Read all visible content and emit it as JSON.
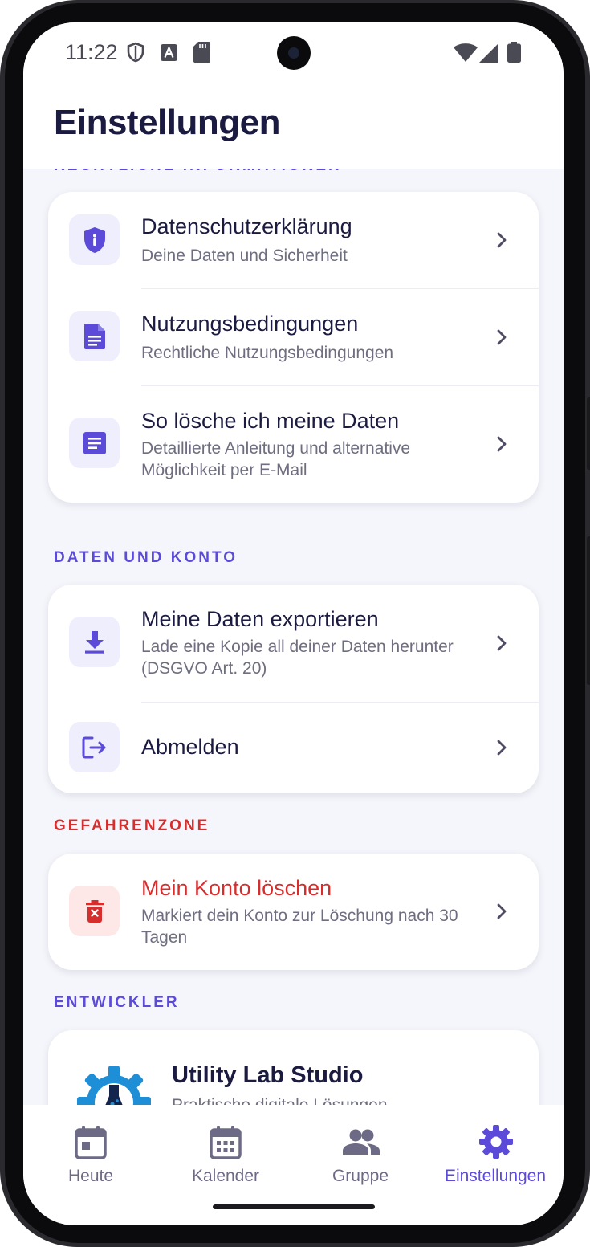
{
  "status": {
    "time": "11:22"
  },
  "header": {
    "title": "Einstellungen"
  },
  "sections": {
    "legal": {
      "label": "RECHTLICHE INFORMATIONEN",
      "items": [
        {
          "title": "Datenschutzerklärung",
          "subtitle": "Deine Daten und Sicherheit",
          "icon": "shield-info-icon"
        },
        {
          "title": "Nutzungsbedingungen",
          "subtitle": "Rechtliche Nutzungsbedingungen",
          "icon": "document-icon"
        },
        {
          "title": "So lösche ich meine Daten",
          "subtitle": "Detaillierte Anleitung und alternative Möglichkeit per E-Mail",
          "icon": "article-icon"
        }
      ]
    },
    "account": {
      "label": "DATEN UND KONTO",
      "items": [
        {
          "title": "Meine Daten exportieren",
          "subtitle": "Lade eine Kopie all deiner Daten herunter (DSGVO Art. 20)",
          "icon": "download-icon"
        },
        {
          "title": "Abmelden",
          "icon": "logout-icon"
        }
      ]
    },
    "danger": {
      "label": "GEFAHRENZONE",
      "items": [
        {
          "title": "Mein Konto löschen",
          "subtitle": "Markiert dein Konto zur Löschung nach 30 Tagen",
          "icon": "delete-icon"
        }
      ]
    },
    "developer": {
      "label": "ENTWICKLER",
      "name": "Utility Lab Studio",
      "tagline": "Praktische digitale Lösungen"
    }
  },
  "nav": {
    "items": [
      {
        "label": "Heute",
        "icon": "calendar-today-icon"
      },
      {
        "label": "Kalender",
        "icon": "calendar-month-icon"
      },
      {
        "label": "Gruppe",
        "icon": "group-icon"
      },
      {
        "label": "Einstellungen",
        "icon": "gear-icon",
        "active": true
      }
    ]
  },
  "colors": {
    "accent": "#5b4bd8",
    "danger": "#d62d2d",
    "title": "#1b1a40",
    "background": "#f5f6fb"
  }
}
